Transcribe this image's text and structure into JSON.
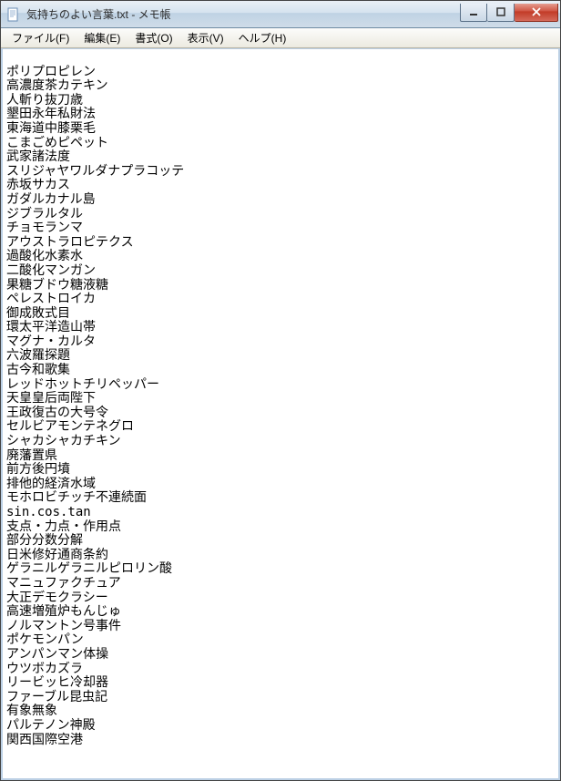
{
  "window": {
    "title": "気持ちのよい言葉.txt - メモ帳"
  },
  "menu": {
    "file": "ファイル(F)",
    "edit": "編集(E)",
    "format": "書式(O)",
    "view": "表示(V)",
    "help": "ヘルプ(H)"
  },
  "content_lines": [
    "ポリプロピレン",
    "高濃度茶カテキン",
    "人斬り抜刀歳",
    "墾田永年私財法",
    "東海道中膝栗毛",
    "こまごめピペット",
    "武家諸法度",
    "スリジャヤワルダナプラコッテ",
    "赤坂サカス",
    "ガダルカナル島",
    "ジブラルタル",
    "チョモランマ",
    "アウストラロピテクス",
    "過酸化水素水",
    "二酸化マンガン",
    "果糖ブドウ糖液糖",
    "ペレストロイカ",
    "御成敗式目",
    "環太平洋造山帯",
    "マグナ・カルタ",
    "六波羅探題",
    "古今和歌集",
    "レッドホットチリペッパー",
    "天皇皇后両陛下",
    "王政復古の大号令",
    "セルビアモンテネグロ",
    "シャカシャカチキン",
    "廃藩置県",
    "前方後円墳",
    "排他的経済水域",
    "モホロビチッチ不連続面",
    "sin.cos.tan",
    "支点・力点・作用点",
    "部分分数分解",
    "日米修好通商条約",
    "ゲラニルゲラニルピロリン酸",
    "マニュファクチュア",
    "大正デモクラシー",
    "高速増殖炉もんじゅ",
    "ノルマントン号事件",
    "ポケモンパン",
    "アンパンマン体操",
    "ウツボカズラ",
    "リービッヒ冷却器",
    "ファーブル昆虫記",
    "有象無象",
    "パルテノン神殿",
    "関西国際空港"
  ]
}
